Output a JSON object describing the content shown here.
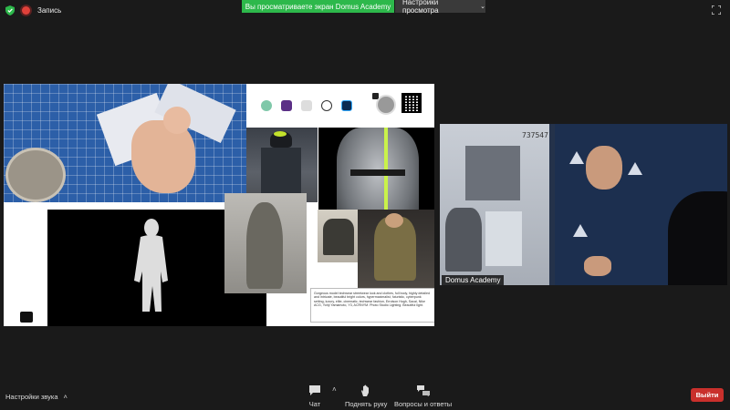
{
  "topbar": {
    "recording_label": "Запись",
    "share_banner": "Вы просматриваете экран Domus Academy",
    "view_settings": "Настройки просмотра"
  },
  "slide": {
    "prompt_text": "Gorgeous model techwear streetwear look and clothes, full body, highly detailed and intricate, beautiful bright colors, hypermaximalist, futuristic, cyberpunk setting, luxury, elite, cinematic, techwear fashion, Errolson Hugh, Sacai, Nike ACG, Yohji Yamamoto, Y3, ACRNYM. Photo Studio Lighting. Beautiful light."
  },
  "video": {
    "speaker_label": "Domus Academy",
    "screen_number": "737547"
  },
  "toolbar": {
    "sound_settings": "Настройки звука",
    "chat": "Чат",
    "raise_hand": "Поднять руку",
    "qa": "Вопросы и ответы",
    "leave": "Выйти"
  },
  "colors": {
    "share_banner": "#2db84b",
    "leave_button": "#c9302c",
    "record_dot": "#e0413a"
  }
}
